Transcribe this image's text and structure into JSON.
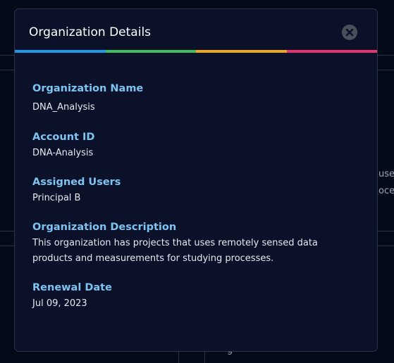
{
  "background": {
    "text_fragment_1": "use",
    "text_fragment_2": "oces",
    "text_fragment_3": "g"
  },
  "modal": {
    "title": "Organization Details",
    "close_icon": "close-circle-icon",
    "accent_colors": [
      "#1e9be8",
      "#3fbf5c",
      "#f0a818",
      "#e8336e"
    ],
    "fields": {
      "org_name": {
        "label": "Organization Name",
        "value": "DNA_Analysis"
      },
      "account_id": {
        "label": "Account ID",
        "value": "DNA-Analysis"
      },
      "assigned_users": {
        "label": "Assigned Users",
        "value": "Principal B"
      },
      "description": {
        "label": "Organization Description",
        "value": "This organization has projects that uses remotely sensed data products and measurements for studying processes."
      },
      "renewal_date": {
        "label": "Renewal Date",
        "value": "Jul 09, 2023"
      }
    }
  }
}
